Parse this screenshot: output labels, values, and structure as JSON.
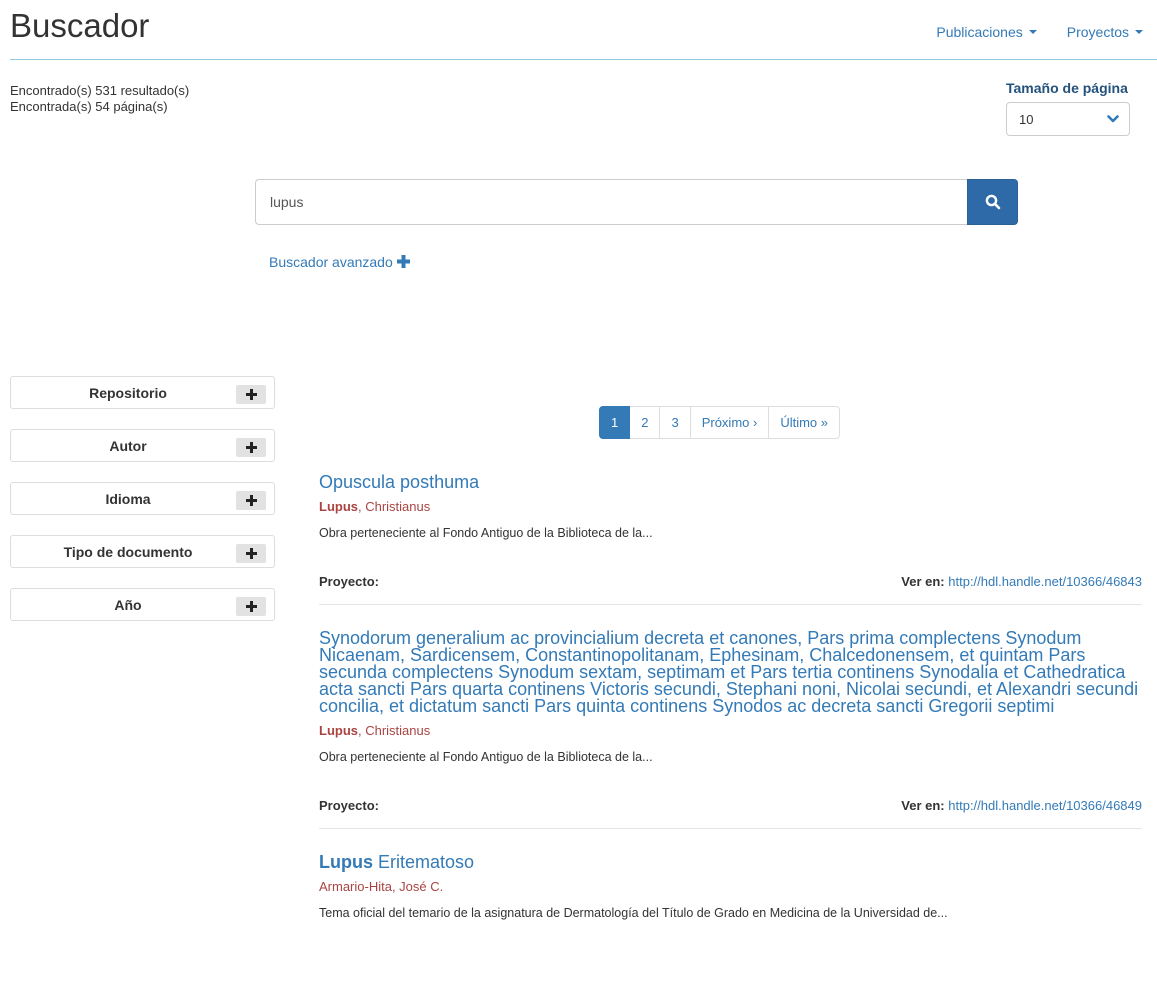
{
  "header": {
    "title": "Buscador",
    "nav": [
      {
        "label": "Publicaciones"
      },
      {
        "label": "Proyectos"
      }
    ]
  },
  "counts": {
    "results": "Encontrado(s) 531 resultado(s)",
    "pages": "Encontrada(s) 54 página(s)"
  },
  "page_size": {
    "label": "Tamaño de página",
    "selected": "10"
  },
  "search": {
    "value": "lupus",
    "advanced_label": "Buscador avanzado"
  },
  "facets": [
    {
      "label": "Repositorio"
    },
    {
      "label": "Autor"
    },
    {
      "label": "Idioma"
    },
    {
      "label": "Tipo de documento"
    },
    {
      "label": "Año"
    }
  ],
  "pagination": {
    "pages": [
      "1",
      "2",
      "3"
    ],
    "next": "Próximo ›",
    "last": "Último »",
    "active_page": "1"
  },
  "results": [
    {
      "title_pre": "",
      "title_bold": "",
      "title_rest": "Opuscula posthuma",
      "author_bold": "Lupus",
      "author_rest": ", Christianus",
      "description": "Obra perteneciente al Fondo Antiguo de la Biblioteca de la...",
      "project_label": "Proyecto:",
      "view_label": "Ver en:",
      "url": "http://hdl.handle.net/10366/46843"
    },
    {
      "title_pre": "",
      "title_bold": "",
      "title_rest": "Synodorum generalium ac provincialium decreta et canones, Pars prima complectens Synodum Nicaenam, Sardicensem, Constantinopolitanam, Ephesinam, Chalcedonensem, et quintam Pars secunda complectens Synodum sextam, septimam et Pars tertia continens Synodalia et Cathedratica acta sancti Pars quarta continens Victoris secundi, Stephani noni, Nicolai secundi, et Alexandri secundi concilia, et dictatum sancti Pars quinta continens Synodos ac decreta sancti Gregorii septimi",
      "author_bold": "Lupus",
      "author_rest": ", Christianus",
      "description": "Obra perteneciente al Fondo Antiguo de la Biblioteca de la...",
      "project_label": "Proyecto:",
      "view_label": "Ver en:",
      "url": "http://hdl.handle.net/10366/46849"
    },
    {
      "title_pre": "",
      "title_bold": "Lupus",
      "title_rest": " Eritematoso",
      "author_bold": "",
      "author_rest": "Armario-Hita, José C.",
      "description": "Tema oficial del temario de la asignatura de Dermatología del Título de Grado en Medicina de la Universidad de...",
      "project_label": "",
      "view_label": "",
      "url": ""
    }
  ],
  "colors": {
    "link": "#337ab7",
    "author": "#a94442",
    "search_button": "#2f6aa8",
    "rule": "#8ecae0"
  }
}
